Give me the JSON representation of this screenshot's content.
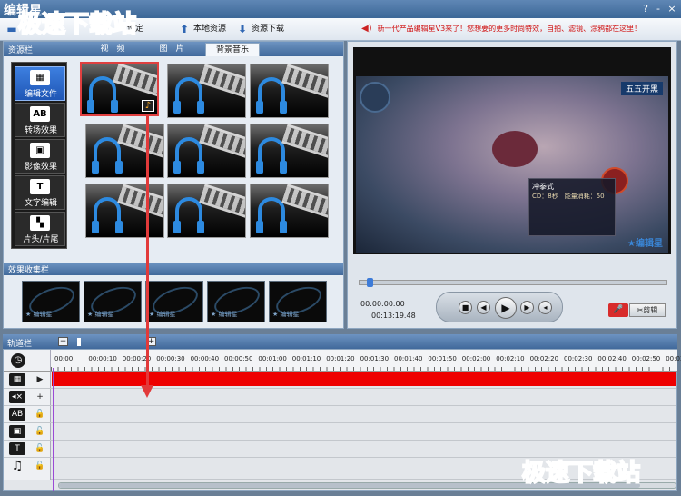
{
  "app": {
    "title": "编辑星",
    "help": "?",
    "minimize": "-",
    "close": "×"
  },
  "toolbar": {
    "settings": "设定",
    "local_resources": "本地资源",
    "resource_download": "资源下载",
    "notice": "新一代产品编辑星V3来了！您想要的更多时尚特效，自拍、滤镜、涂鸦都在这里！"
  },
  "resource_panel": {
    "title": "资源栏",
    "tabs": [
      "视　频",
      "图　片",
      "背景音乐"
    ],
    "active_tab": 2,
    "nav": [
      "编辑文件",
      "转场效果",
      "影像效果",
      "文字编辑",
      "片头/片尾"
    ],
    "nav_icons": [
      "film-icon",
      "ab-icon",
      "effects-icon",
      "text-icon",
      "blocks-icon"
    ]
  },
  "effect_panel": {
    "title": "效果收集栏",
    "watermark": "★ 编辑星"
  },
  "preview": {
    "hud_title": "冲拳式",
    "hud_text": "CD：8秒　能量消耗：50",
    "game_logo": "五五开黑",
    "watermark": "★编辑星",
    "current_time": "00:00:00.00",
    "total_time": "00:13:19.48",
    "clip_label": "剪辑"
  },
  "track_panel": {
    "title": "轨道栏",
    "zoom_minus": "−",
    "zoom_plus": "+",
    "timestamps": [
      "00:00",
      "00:00:10",
      "00:00:20",
      "00:00:30",
      "00:00:40",
      "00:00:50",
      "00:01:00",
      "00:01:10",
      "00:01:20",
      "00:01:30",
      "00:01:40",
      "00:01:50",
      "00:02:00",
      "00:02:10",
      "00:02:20",
      "00:02:30",
      "00:02:40",
      "00:02:50",
      "00:03:00"
    ]
  },
  "watermark": "极速下载站",
  "colors": {
    "accent": "#3d7bd8",
    "track_fill": "#ee0000",
    "arrow": "#e23a3a"
  }
}
